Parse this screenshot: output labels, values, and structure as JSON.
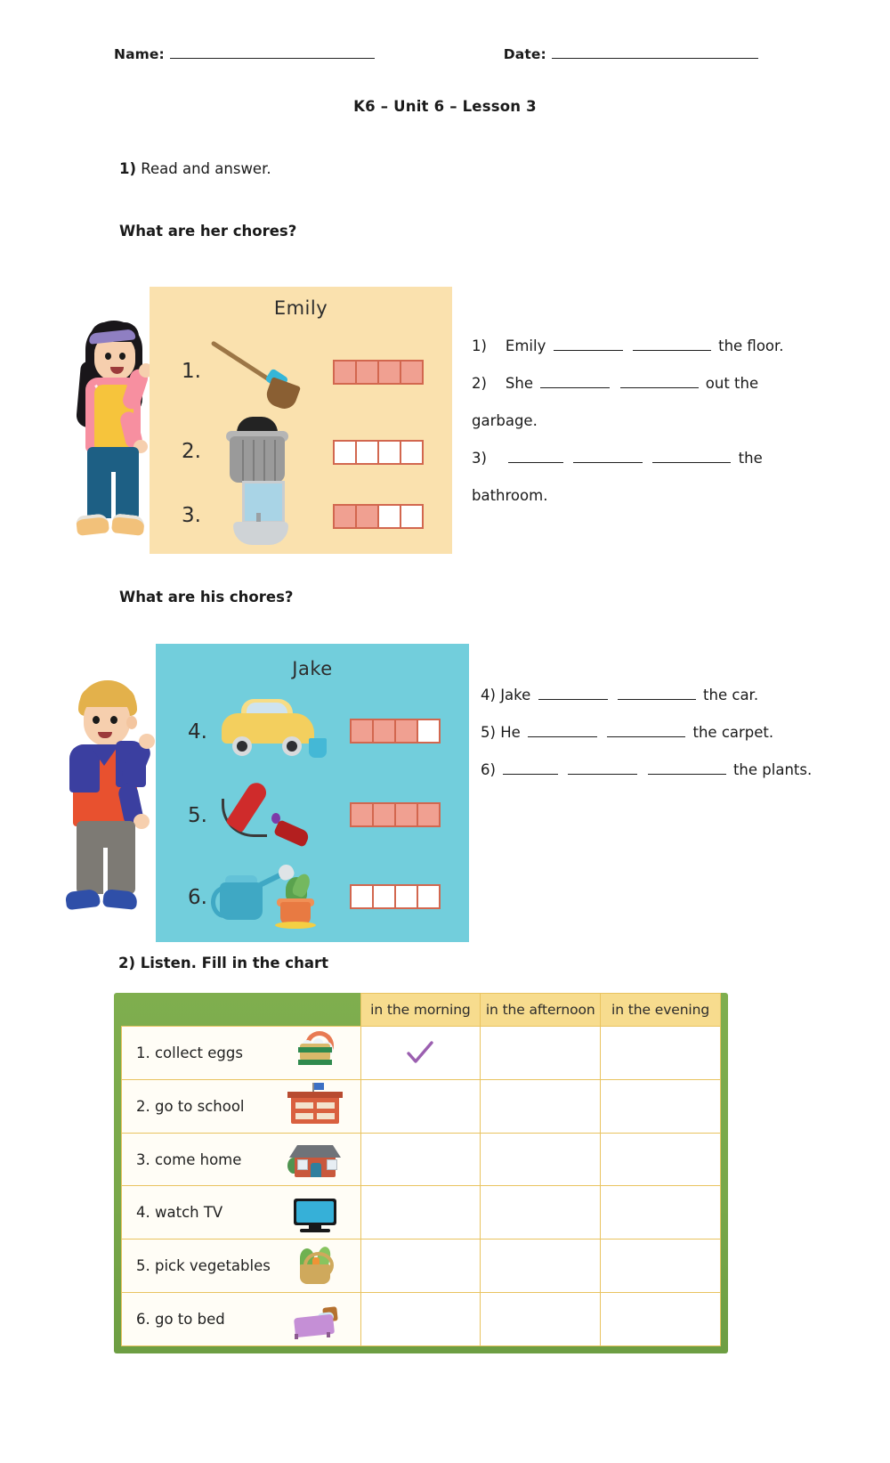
{
  "header": {
    "name_label": "Name:",
    "date_label": "Date:",
    "lesson_title": "K6 – Unit 6 – Lesson 3"
  },
  "task1": {
    "number": "1)",
    "instruction": "Read and answer.",
    "prompt_her": "What are her chores?",
    "prompt_his": "What are his chores?"
  },
  "emily_panel": {
    "title": "Emily",
    "background_color": "#fae1ae",
    "rows": [
      {
        "number": "1.",
        "icon": "broom-icon",
        "boxes_total": 4,
        "boxes_filled": 4
      },
      {
        "number": "2.",
        "icon": "trash-can-icon",
        "boxes_total": 4,
        "boxes_filled": 0
      },
      {
        "number": "3.",
        "icon": "bathroom-sink-mirror-icon",
        "boxes_total": 4,
        "boxes_filled": 2
      }
    ]
  },
  "jake_panel": {
    "title": "Jake",
    "background_color": "#72cedc",
    "rows": [
      {
        "number": "4.",
        "icon": "car-wash-icon",
        "boxes_total": 4,
        "boxes_filled": 3
      },
      {
        "number": "5.",
        "icon": "vacuum-cleaner-icon",
        "boxes_total": 4,
        "boxes_filled": 4
      },
      {
        "number": "6.",
        "icon": "watering-can-plant-icon",
        "boxes_total": 4,
        "boxes_filled": 0
      }
    ]
  },
  "answers_her": [
    {
      "num": "1)",
      "pre": "Emily",
      "mid": "",
      "post": "the floor."
    },
    {
      "num": "2)",
      "pre": "She",
      "mid": "",
      "post": "out the garbage."
    },
    {
      "num": "3)",
      "pre": "",
      "mid": "",
      "post": "the bathroom."
    }
  ],
  "answers_his": [
    {
      "num": "4)",
      "pre": "Jake",
      "post": "the car."
    },
    {
      "num": "5)",
      "pre": "He",
      "post": "the carpet."
    },
    {
      "num": "6)",
      "pre": "",
      "post": "the plants."
    }
  ],
  "answer_fragments": {
    "a1_num": "1)",
    "a1_pre": "Emily",
    "a1_post": "the floor.",
    "a2_num": "2)",
    "a2_pre": "She",
    "a2_post": "out the",
    "a2_wrap": "garbage.",
    "a3_num": "3)",
    "a3_post": "the",
    "a3_wrap": "bathroom.",
    "a4_num": "4)",
    "a4_pre": "Jake",
    "a4_post": "the car.",
    "a5_num": "5)",
    "a5_pre": "He",
    "a5_post": "the carpet.",
    "a6_num": "6)",
    "a6_post": "the",
    "a6_wrap": "plants."
  },
  "task2": {
    "heading": "2) Listen. Fill in the chart"
  },
  "chart_data": {
    "type": "table",
    "title": "Listen. Fill in the chart",
    "columns": [
      "",
      "in the morning",
      "in the afternoon",
      "in the evening"
    ],
    "rows": [
      {
        "label": "1. collect eggs",
        "icon": "egg-basket-icon",
        "morning": "check",
        "afternoon": "",
        "evening": ""
      },
      {
        "label": "2. go to school",
        "icon": "school-icon",
        "morning": "",
        "afternoon": "",
        "evening": ""
      },
      {
        "label": "3. come home",
        "icon": "house-icon",
        "morning": "",
        "afternoon": "",
        "evening": ""
      },
      {
        "label": "4. watch TV",
        "icon": "television-icon",
        "morning": "",
        "afternoon": "",
        "evening": ""
      },
      {
        "label": "5. pick vegetables",
        "icon": "vegetable-basket-icon",
        "morning": "",
        "afternoon": "",
        "evening": ""
      },
      {
        "label": "6. go to bed",
        "icon": "bed-icon",
        "morning": "",
        "afternoon": "",
        "evening": ""
      }
    ],
    "header_bg": "#f7dc8e",
    "frame_bg": "#7fae4e",
    "grid_color": "#e9c35f",
    "check_color": "#9b5fb0"
  }
}
